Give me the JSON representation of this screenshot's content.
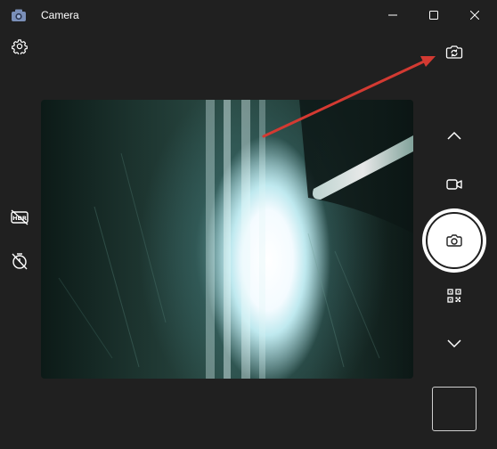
{
  "window": {
    "title": "Camera",
    "app_icon": "camera-app-icon"
  },
  "title_controls": {
    "minimize": "minimize-icon",
    "maximize": "maximize-icon",
    "close": "close-icon"
  },
  "toolbar_left": {
    "settings": "gear-icon",
    "hdr": "hdr-off-icon",
    "timer": "timer-off-icon"
  },
  "toolbar_right": {
    "switch_camera": "switch-camera-icon",
    "scroll_up": "chevron-up-icon",
    "video_mode": "video-camera-icon",
    "photo_shutter": "camera-icon",
    "qr_mode": "qr-code-icon",
    "scroll_down": "chevron-down-icon",
    "last_capture": "thumbnail"
  },
  "colors": {
    "background": "#202020",
    "icon": "#ffffff",
    "annotation_arrow": "#d33a32"
  }
}
